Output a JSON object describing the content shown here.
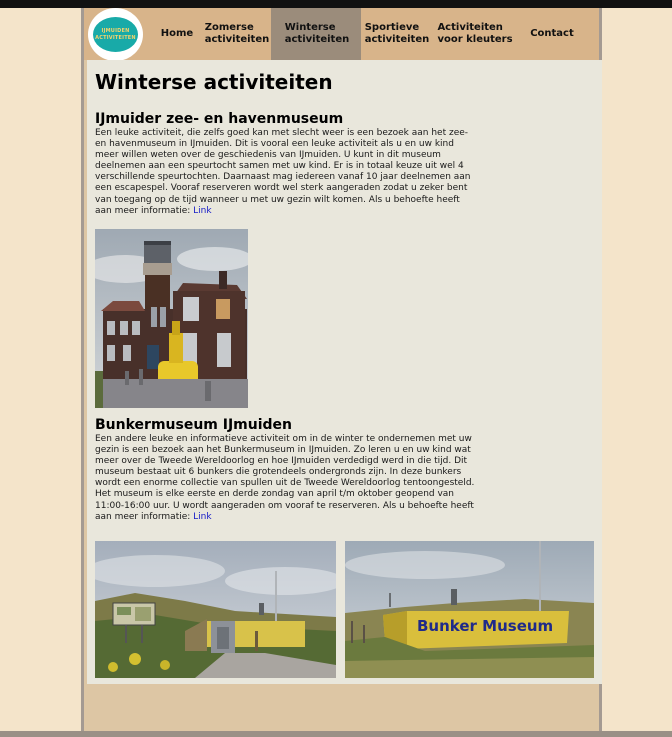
{
  "logo": {
    "line1": "IJMUIDEN",
    "line2": "ACTIVITEITEN"
  },
  "nav": {
    "home": "Home",
    "zomerse": "Zomerse\nactiviteiten",
    "winterse": "Winterse\nactiviteiten",
    "sportieve": "Sportieve\nactiviteiten",
    "kleuters": "Activiteiten\nvoor kleuters",
    "contact": "Contact"
  },
  "page_title": "Winterse activiteiten",
  "sections": [
    {
      "title": "IJmuider zee- en havenmuseum",
      "text": "Een leuke activiteit, die zelfs goed kan met slecht weer is een bezoek aan het zee- en havenmuseum in IJmuiden. Dit is vooral een leuke activiteit als u en uw kind meer willen weten over de geschiedenis van IJmuiden. U kunt in dit museum deelnemen aan een speurtocht samen met uw kind. Er is in totaal keuze uit wel 4 verschillende speurtochten. Daarnaast mag iedereen vanaf 10 jaar deelnemen aan een escapespel. Vooraf reserveren wordt wel sterk aangeraden zodat u zeker bent van toegang op de tijd wanneer u met uw gezin wilt komen. Als u behoefte heeft aan meer informatie: ",
      "link": "Link"
    },
    {
      "title": "Bunkermuseum IJmuiden",
      "text": "Een andere leuke en informatieve activiteit om in de winter te ondernemen met uw gezin is een bezoek aan het Bunkermuseum in IJmuiden. Zo leren u en uw kind wat meer over de Tweede Wereldoorlog en hoe IJmuiden verdedigd werd in die tijd. Dit museum bestaat uit 6 bunkers die grotendeels ondergronds zijn. In deze bunkers wordt een enorme collectie van spullen uit de Tweede Wereldoorlog tentoongesteld. Het museum is elke eerste en derde zondag van april t/m oktober geopend van 11:00-16:00 uur. U wordt aangeraden om vooraf te reserveren. Als u behoefte heeft aan meer informatie: ",
      "link": "Link"
    }
  ],
  "bunker_sign": "Bunker Museum",
  "colors": {
    "background": "#f4e4ca",
    "nav": "#d8b48a",
    "nav_active": "#9b8c7b",
    "content": "#e9e7dc",
    "link": "#1a20c8",
    "logo": "#18aaa8"
  }
}
